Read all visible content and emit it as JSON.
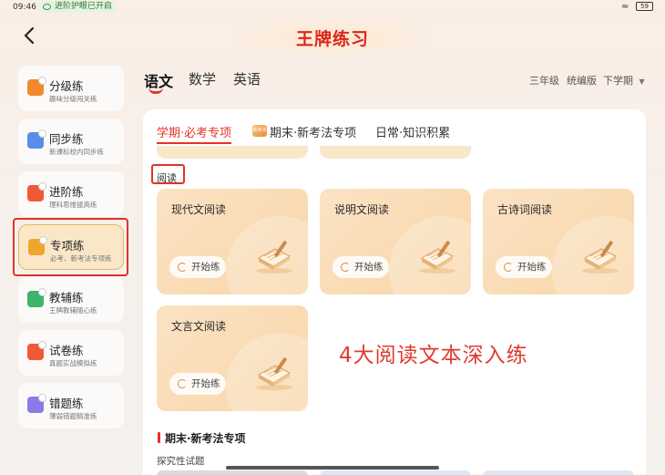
{
  "status_bar": {
    "time": "09:46",
    "eye_care": "进阶护眼已开启",
    "battery": "59"
  },
  "header": {
    "title": "王牌练习"
  },
  "sidebar": {
    "items": [
      {
        "label": "分级练",
        "sub": "趣味分级闯关练",
        "icon_color": "#f08a2c"
      },
      {
        "label": "同步练",
        "sub": "新课标校内同步练",
        "icon_color": "#5b8de8"
      },
      {
        "label": "进阶练",
        "sub": "理科思维拔高练",
        "icon_color": "#ef5a35"
      },
      {
        "label": "专项练",
        "sub": "必考、新考法专项练",
        "icon_color": "#f0a52c",
        "active": true
      },
      {
        "label": "教辅练",
        "sub": "王牌教辅随心练",
        "icon_color": "#3cb56a"
      },
      {
        "label": "试卷练",
        "sub": "真题实战模拟练",
        "icon_color": "#ef5a35"
      },
      {
        "label": "错题练",
        "sub": "薄弱错题精准练",
        "icon_color": "#8a7be8"
      }
    ]
  },
  "subjects": {
    "tabs": [
      "语文",
      "数学",
      "英语"
    ],
    "selected": "语文"
  },
  "filters": {
    "grade": "三年级",
    "edition": "统编版",
    "term": "下学期"
  },
  "panel": {
    "tabs": [
      "学期·必考专项",
      "期末·新考法专项",
      "日常·知识积累"
    ],
    "selected_tab": "学期·必考专项",
    "badge_text": "新考法",
    "section": "阅读",
    "cards": [
      {
        "name": "现代文阅读",
        "action": "开始练"
      },
      {
        "name": "说明文阅读",
        "action": "开始练"
      },
      {
        "name": "古诗词阅读",
        "action": "开始练"
      },
      {
        "name": "文言文阅读",
        "action": "开始练"
      }
    ],
    "annotation": "4大阅读文本深入练",
    "section2": "期末·新考法专项",
    "section3": "探究性试题"
  },
  "colors": {
    "accent": "#e5322a",
    "card": "#f9dcb5",
    "title": "#d9281e"
  }
}
